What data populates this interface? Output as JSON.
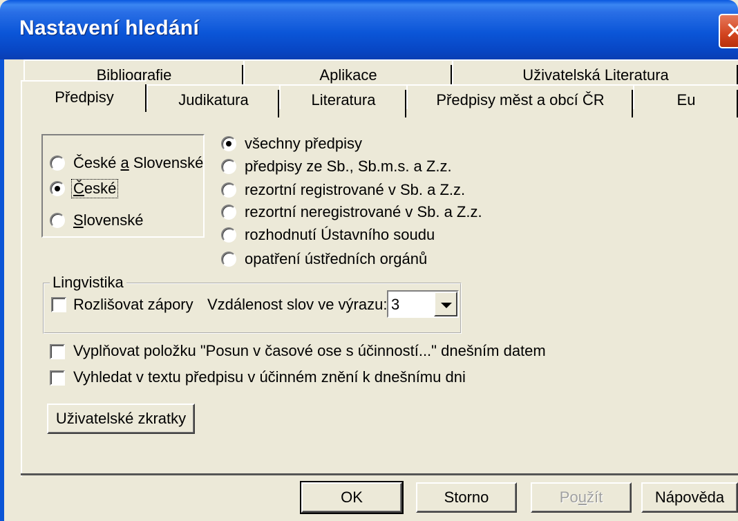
{
  "window": {
    "title": "Nastavení hledání",
    "close_glyph": "✕"
  },
  "tabs_back": [
    "Bibliografie",
    "Aplikace",
    "Uživatelská Literatura"
  ],
  "tabs_front": [
    "Předpisy",
    "Judikatura",
    "Literatura",
    "Předpisy měst a obcí ČR",
    "Eu"
  ],
  "active_tab": "Předpisy",
  "scope": {
    "options": [
      {
        "label_pre": "České ",
        "label_u": "a",
        "label_post": " Slovenské",
        "selected": false
      },
      {
        "label_pre": "",
        "label_u": "Č",
        "label_post": "eské",
        "selected": true
      },
      {
        "label_pre": "",
        "label_u": "S",
        "label_post": "lovenské",
        "selected": false
      }
    ]
  },
  "types": {
    "options": [
      {
        "label": "všechny předpisy",
        "selected": true
      },
      {
        "label": "předpisy ze Sb., Sb.m.s. a Z.z.",
        "selected": false
      },
      {
        "label": "rezortní registrované v Sb. a Z.z.",
        "selected": false
      },
      {
        "label": "rezortní neregistrované v Sb. a Z.z.",
        "selected": false
      },
      {
        "label": "rozhodnutí Ústavního soudu",
        "selected": false
      },
      {
        "label": "opatření ústředních orgánů",
        "selected": false
      }
    ]
  },
  "linguistics": {
    "legend": "Lingvistika",
    "distinguish_negations": "Rozlišovat zápory",
    "distance_label": "Vzdálenost slov ve výrazu:",
    "distance_value": "3"
  },
  "options": {
    "fill_date": "Vyplňovat položku \"Posun v časové ose s účinností...\" dnešním datem",
    "search_current": "Vyhledat v textu předpisu v účinném znění k dnešnímu dni"
  },
  "user_shortcuts_button": "Uživatelské zkratky",
  "footer": {
    "ok": "OK",
    "cancel": "Storno",
    "apply_pre": "Po",
    "apply_u": "u",
    "apply_post": "žít",
    "help": "Nápověda"
  }
}
